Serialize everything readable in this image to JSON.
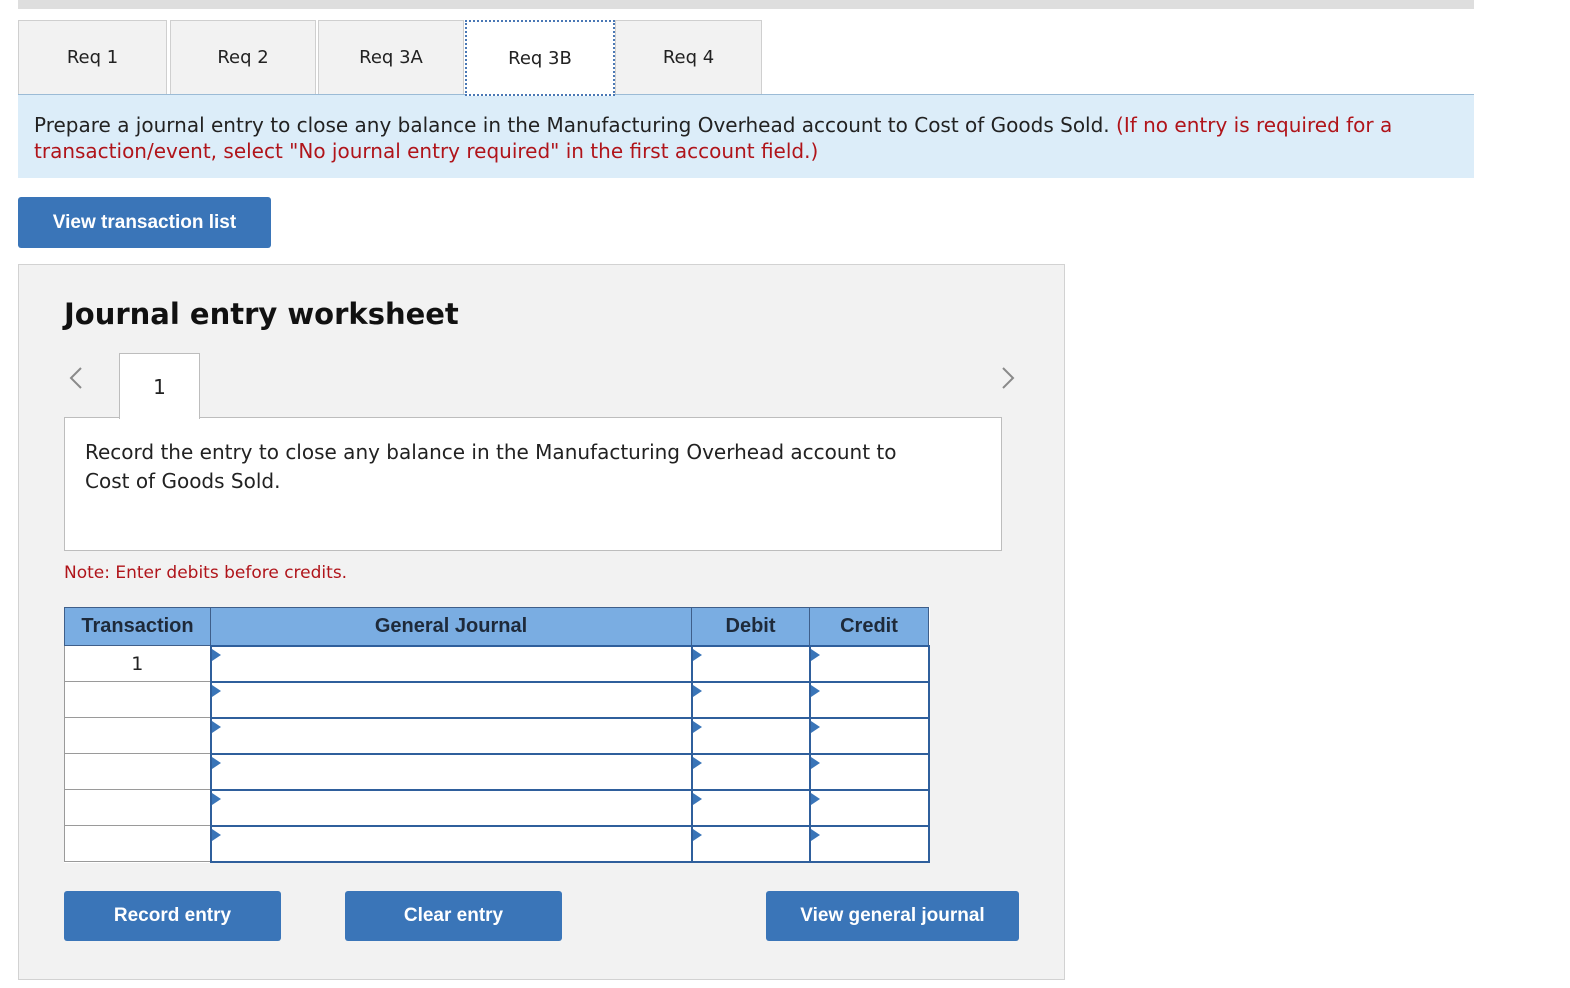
{
  "tabs": [
    {
      "label": "Req 1",
      "active": false
    },
    {
      "label": "Req 2",
      "active": false
    },
    {
      "label": "Req 3A",
      "active": false
    },
    {
      "label": "Req 3B",
      "active": true
    },
    {
      "label": "Req 4",
      "active": false
    }
  ],
  "instructions": {
    "main": "Prepare a journal entry to close any balance in the Manufacturing Overhead account to Cost of Goods Sold.",
    "note": "(If no entry is required for a transaction/event, select \"No journal entry required\" in the first account field.)"
  },
  "buttons": {
    "view_transaction_list": "View transaction list",
    "record_entry": "Record entry",
    "clear_entry": "Clear entry",
    "view_general_journal": "View general journal"
  },
  "worksheet": {
    "title": "Journal entry worksheet",
    "entry_tab": "1",
    "description": "Record the entry to close any balance in the Manufacturing Overhead account to Cost of Goods Sold.",
    "note": "Note: Enter debits before credits.",
    "columns": [
      "Transaction",
      "General Journal",
      "Debit",
      "Credit"
    ],
    "rows": [
      {
        "transaction": "1",
        "account": "",
        "debit": "",
        "credit": ""
      },
      {
        "transaction": "",
        "account": "",
        "debit": "",
        "credit": ""
      },
      {
        "transaction": "",
        "account": "",
        "debit": "",
        "credit": ""
      },
      {
        "transaction": "",
        "account": "",
        "debit": "",
        "credit": ""
      },
      {
        "transaction": "",
        "account": "",
        "debit": "",
        "credit": ""
      },
      {
        "transaction": "",
        "account": "",
        "debit": "",
        "credit": ""
      }
    ]
  },
  "colors": {
    "accent": "#3a75b8",
    "header": "#7aade2",
    "instruction_bg": "#dcedf9",
    "warning": "#b0141a"
  }
}
